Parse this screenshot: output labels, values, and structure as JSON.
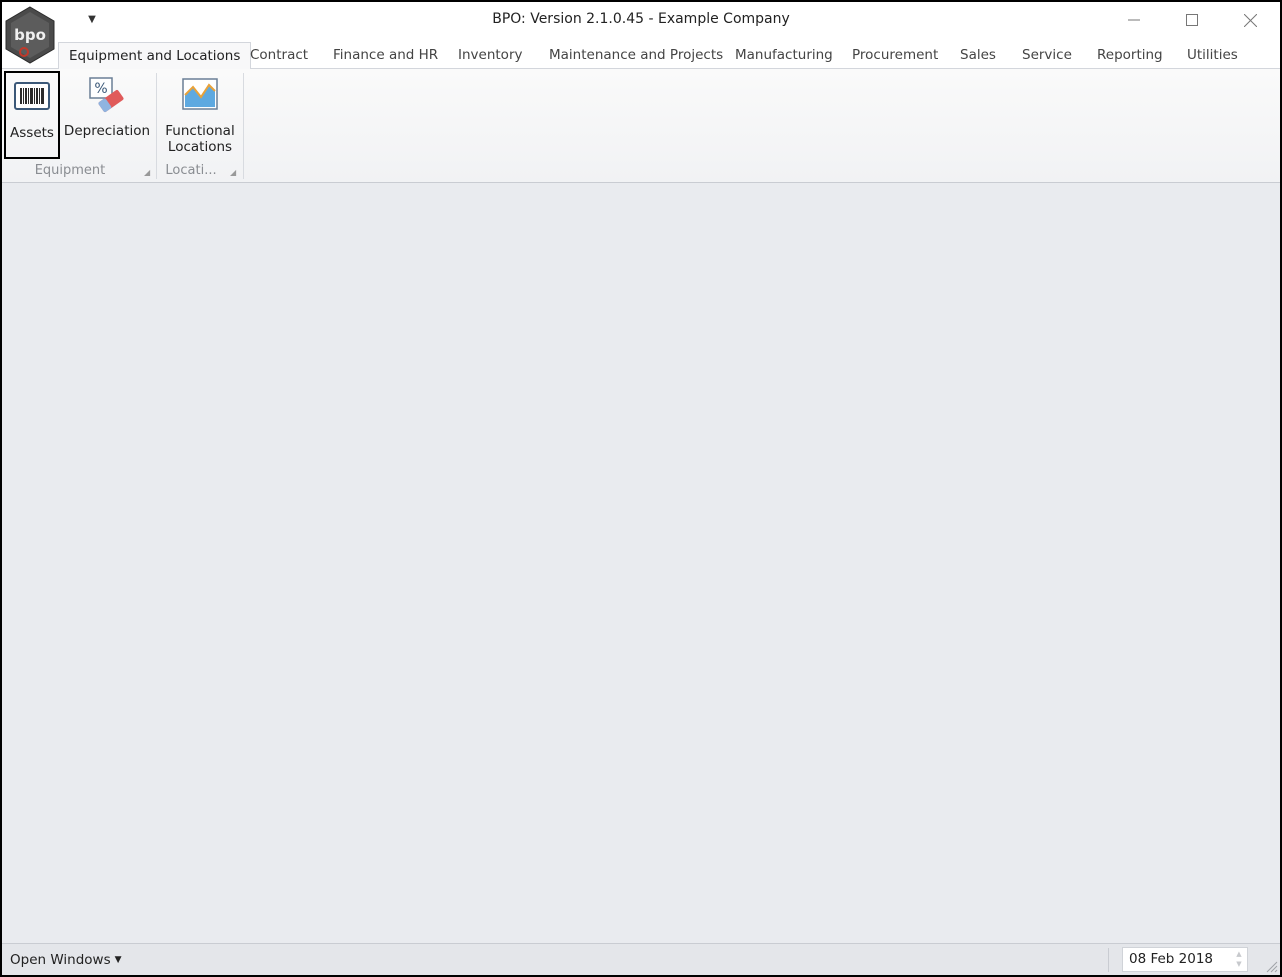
{
  "window": {
    "title": "BPO: Version 2.1.0.45 - Example Company",
    "logo_text": "bpo"
  },
  "tabs": [
    {
      "label": "Equipment and Locations",
      "active": true
    },
    {
      "label": "Contract"
    },
    {
      "label": "Finance and HR"
    },
    {
      "label": "Inventory"
    },
    {
      "label": "Maintenance and Projects"
    },
    {
      "label": "Manufacturing"
    },
    {
      "label": "Procurement"
    },
    {
      "label": "Sales"
    },
    {
      "label": "Service"
    },
    {
      "label": "Reporting"
    },
    {
      "label": "Utilities"
    }
  ],
  "ribbon": {
    "groups": [
      {
        "label": "Equipment",
        "buttons": [
          {
            "label": "Assets",
            "icon": "barcode-icon",
            "selected": true
          },
          {
            "label": "Depreciation",
            "icon": "depreciation-icon"
          }
        ]
      },
      {
        "label": "Locati...",
        "buttons": [
          {
            "label_line1": "Functional",
            "label_line2": "Locations",
            "icon": "map-chart-icon"
          }
        ]
      }
    ]
  },
  "statusbar": {
    "open_windows": "Open Windows",
    "date": "08 Feb 2018"
  },
  "colors": {
    "background": "#e9ebef",
    "ribbon": "#f5f6f7",
    "selection_border": "#000000"
  }
}
